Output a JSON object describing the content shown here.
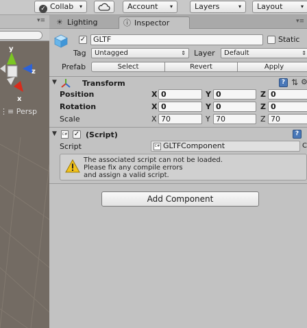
{
  "toolbar": {
    "collab_label": "Collab",
    "account_label": "Account",
    "layers_label": "Layers",
    "layout_label": "Layout"
  },
  "scene": {
    "persp_label": "Persp",
    "gizmo_y": "y",
    "gizmo_z": "z",
    "gizmo_x": "x",
    "colors": {
      "y_axis": "#7bc623",
      "z_axis": "#2c62d8",
      "x_axis": "#d92b1b",
      "background": "#736b63"
    }
  },
  "tabs": [
    {
      "label": "Lighting",
      "icon": "lightbulb-icon"
    },
    {
      "label": "Inspector",
      "icon": "info-icon",
      "active": true
    }
  ],
  "inspector": {
    "gameobject": {
      "icon": "cube-icon",
      "active": true,
      "name": "GLTF",
      "static_label": "Static",
      "static": false
    },
    "tag": {
      "label": "Tag",
      "value": "Untagged"
    },
    "layer": {
      "label": "Layer",
      "value": "Default"
    },
    "prefab": {
      "label": "Prefab",
      "select_label": "Select",
      "revert_label": "Revert",
      "apply_label": "Apply"
    },
    "transform": {
      "title": "Transform",
      "position": {
        "label": "Position",
        "x_label": "X",
        "y_label": "Y",
        "z_label": "Z",
        "x": "0",
        "y": "0",
        "z": "0"
      },
      "rotation": {
        "label": "Rotation",
        "x_label": "X",
        "y_label": "Y",
        "z_label": "Z",
        "x": "0",
        "y": "0",
        "z": "0"
      },
      "scale": {
        "label": "Scale",
        "x_label": "X",
        "y_label": "Y",
        "z_label": "Z",
        "x": "70",
        "y": "70",
        "z": "70"
      }
    },
    "script_component": {
      "title": "(Script)",
      "enabled": true,
      "script_label": "Script",
      "script_value": "GLTFComponent",
      "trailing_glyph": "C",
      "warning_lines": [
        "The associated script can not be loaded.",
        "Please fix any compile errors",
        "and assign a valid script."
      ]
    },
    "add_component_label": "Add Component"
  }
}
